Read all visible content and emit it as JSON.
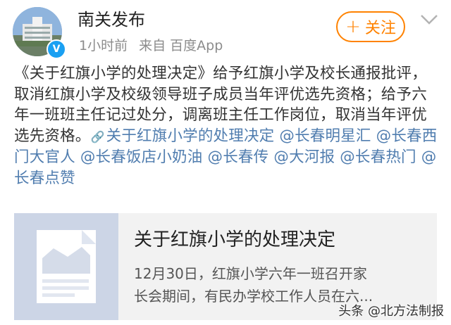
{
  "header": {
    "user_name": "南关发布",
    "time": "1小时前",
    "source": "来自 百度App",
    "follow_label": "关注"
  },
  "post": {
    "segments": [
      {
        "text": "《关于红旗小学的处理决定》给予红旗小学及校长通报批评，取消红旗小学及校级领导班子成员当年评优选先资格；给予六年一班班主任记过处分，调离班主任工作岗位，取消当年评优选先资格。",
        "link": false
      },
      {
        "text": "关于红旗小学的处理决定",
        "link": true,
        "icon": "link-icon"
      },
      {
        "text": " ",
        "link": false
      },
      {
        "text": "@长春明星汇",
        "link": true
      },
      {
        "text": " ",
        "link": false
      },
      {
        "text": "@长春西门大官人",
        "link": true
      },
      {
        "text": " ",
        "link": false
      },
      {
        "text": "@长春饭店小奶油",
        "link": true
      },
      {
        "text": " ",
        "link": false
      },
      {
        "text": "@长春传",
        "link": true
      },
      {
        "text": " ",
        "link": false
      },
      {
        "text": "@大河报",
        "link": true
      },
      {
        "text": " ",
        "link": false
      },
      {
        "text": "@长春热门",
        "link": true
      },
      {
        "text": " ",
        "link": false
      },
      {
        "text": "@长春点赞",
        "link": true
      }
    ]
  },
  "card": {
    "title": "关于红旗小学的处理决定",
    "desc_line1": "12月30日，红旗小学六年一班召开家",
    "desc_line2": "长会期间，有民办学校工作人员在六..."
  },
  "watermark": {
    "text": "头条 @北方法制报"
  },
  "colors": {
    "accent": "#ff8200",
    "link": "#507daf",
    "verified": "#1aa0f2"
  }
}
